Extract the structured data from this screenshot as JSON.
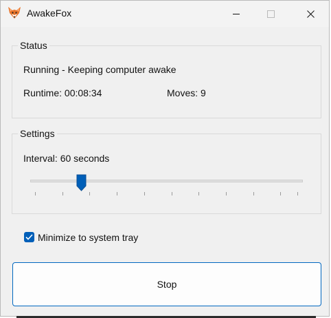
{
  "window": {
    "title": "AwakeFox",
    "icon": "fox-icon"
  },
  "status": {
    "legend": "Status",
    "state_text": "Running - Keeping computer awake",
    "runtime_text": "Runtime: 00:08:34",
    "moves_text": "Moves: 9"
  },
  "settings": {
    "legend": "Settings",
    "interval_text": "Interval: 60 seconds",
    "slider_level": 0.17
  },
  "options": {
    "minimize_to_tray_label": "Minimize to system tray",
    "minimize_to_tray_checked": true
  },
  "actions": {
    "stop_label": "Stop"
  },
  "colors": {
    "accent": "#005fb8",
    "button_border": "#0067c0",
    "window_bg": "#f0f0f0"
  }
}
